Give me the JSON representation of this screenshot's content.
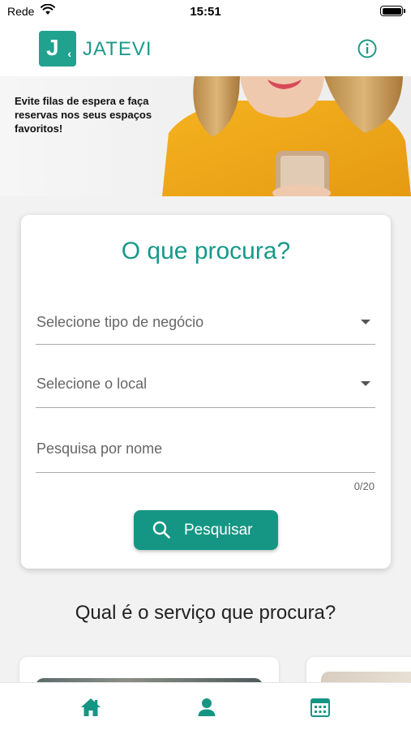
{
  "status_bar": {
    "carrier": "Rede",
    "time": "15:51"
  },
  "header": {
    "logo_letter": "J",
    "app_name": "JATEVI",
    "info_icon": "info-circle-icon"
  },
  "banner": {
    "text": "Evite filas de espera e faça reservas nos seus espaços favoritos!"
  },
  "search": {
    "title": "O que procura?",
    "business_type_placeholder": "Selecione tipo de negócio",
    "location_placeholder": "Selecione o local",
    "name_placeholder": "Pesquisa por nome",
    "name_counter": "0/20",
    "button_label": "Pesquisar"
  },
  "services": {
    "title": "Qual é o serviço que procura?"
  },
  "bottom_nav": {
    "items": [
      {
        "icon": "home-icon",
        "active": true
      },
      {
        "icon": "user-icon",
        "active": false
      },
      {
        "icon": "calendar-icon",
        "active": false
      }
    ]
  },
  "colors": {
    "accent": "#159684",
    "brand": "#21a28f"
  }
}
